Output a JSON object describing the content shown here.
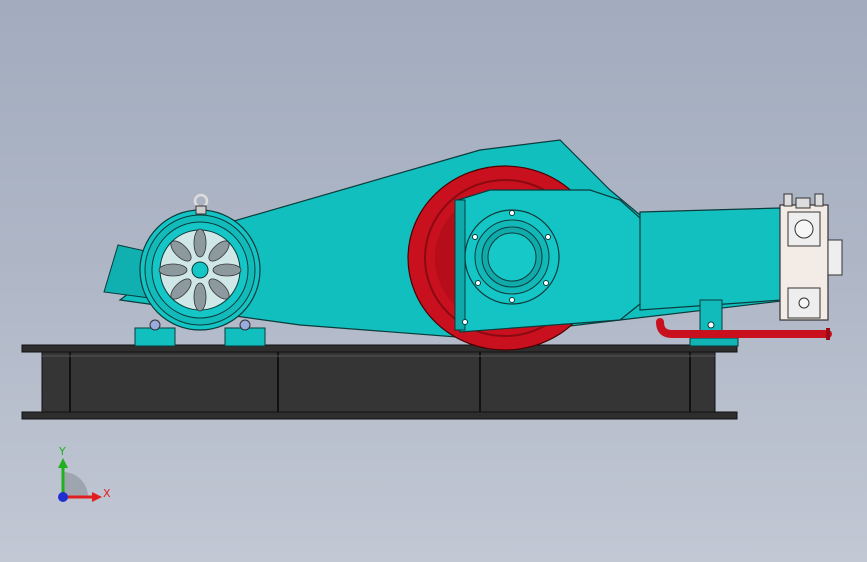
{
  "viewer": {
    "background_top": "#a2acbe",
    "background_bottom": "#c2c8d4"
  },
  "model": {
    "frame_color": "#3a3a3a",
    "body_color": "#12bfbf",
    "flywheel_color": "#c8101e",
    "valve_block_color": "#f3ece6",
    "pipe_color": "#c8101e"
  },
  "triad": {
    "x_label": "X",
    "y_label": "Y",
    "x_color": "#e02020",
    "y_color": "#20b020",
    "z_color": "#2030d0"
  }
}
